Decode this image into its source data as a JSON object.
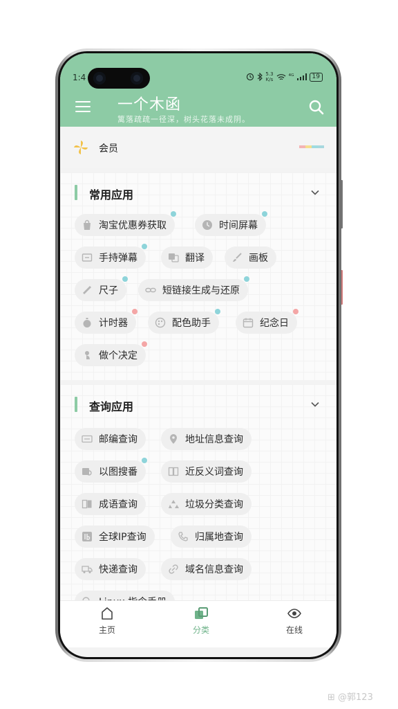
{
  "status_bar": {
    "time": "1:4",
    "net_speed_value": "5.3",
    "net_speed_unit": "K/s",
    "signal": "⁴ᴳ",
    "battery": "19"
  },
  "app_bar": {
    "title": "一个木函",
    "subtitle": "篱落疏疏一径深，树头花落未成阴。"
  },
  "member": {
    "label": "会员"
  },
  "sections": [
    {
      "title": "常用应用",
      "items": [
        {
          "label": "淘宝优惠券获取",
          "icon": "shopping-bag-icon",
          "dot": "teal"
        },
        {
          "label": "时间屏幕",
          "icon": "clock-icon",
          "dot": "teal"
        },
        {
          "label": "手持弹幕",
          "icon": "barrage-icon",
          "dot": "teal"
        },
        {
          "label": "翻译",
          "icon": "translate-icon",
          "dot": ""
        },
        {
          "label": "画板",
          "icon": "paintbrush-icon",
          "dot": ""
        },
        {
          "label": "尺子",
          "icon": "ruler-icon",
          "dot": "teal"
        },
        {
          "label": "短链接生成与还原",
          "icon": "link-icon",
          "dot": "teal"
        },
        {
          "label": "计时器",
          "icon": "stopwatch-icon",
          "dot": "pink"
        },
        {
          "label": "配色助手",
          "icon": "palette-icon",
          "dot": "teal"
        },
        {
          "label": "纪念日",
          "icon": "calendar-icon",
          "dot": "pink"
        },
        {
          "label": "做个决定",
          "icon": "decision-icon",
          "dot": "pink"
        }
      ]
    },
    {
      "title": "查询应用",
      "items": [
        {
          "label": "邮编查询",
          "icon": "postcode-icon",
          "dot": ""
        },
        {
          "label": "地址信息查询",
          "icon": "location-pin-icon",
          "dot": ""
        },
        {
          "label": "以图搜番",
          "icon": "image-search-icon",
          "dot": "teal"
        },
        {
          "label": "近反义词查询",
          "icon": "dictionary-icon",
          "dot": ""
        },
        {
          "label": "成语查询",
          "icon": "book-icon",
          "dot": ""
        },
        {
          "label": "垃圾分类查询",
          "icon": "recycle-icon",
          "dot": ""
        },
        {
          "label": "全球IP查询",
          "icon": "ip-icon",
          "dot": ""
        },
        {
          "label": "归属地查询",
          "icon": "phone-icon",
          "dot": ""
        },
        {
          "label": "快递查询",
          "icon": "truck-icon",
          "dot": ""
        },
        {
          "label": "域名信息查询",
          "icon": "domain-link-icon",
          "dot": ""
        },
        {
          "label": "Linux 指令手册",
          "icon": "search-icon",
          "dot": ""
        }
      ]
    }
  ],
  "bottom_nav": [
    {
      "label": "主页",
      "icon": "home-icon",
      "active": false
    },
    {
      "label": "分类",
      "icon": "category-icon",
      "active": true
    },
    {
      "label": "在线",
      "icon": "eye-icon",
      "active": false
    }
  ],
  "watermark": "@郭123",
  "colors": {
    "accent": "#8dcba5",
    "dot_teal": "#8ed4da",
    "dot_pink": "#f4a6a6",
    "active_nav": "#6fb38a"
  }
}
